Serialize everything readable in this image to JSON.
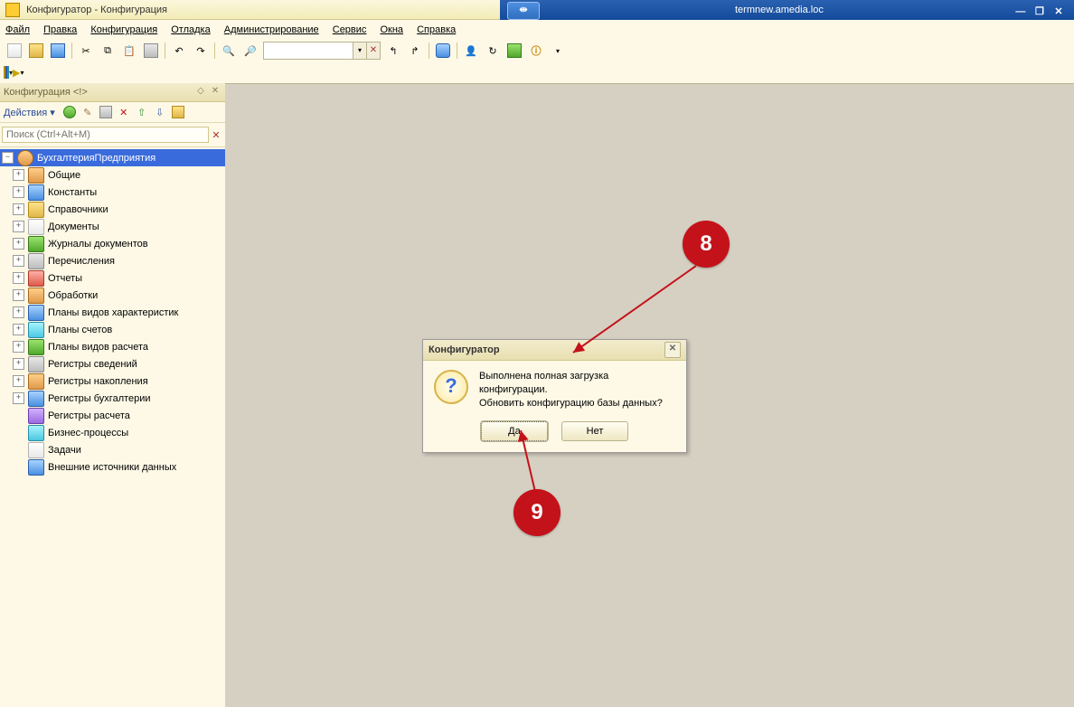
{
  "remote": {
    "host": "termnew.amedia.loc",
    "pin": "⇹"
  },
  "app_title": "Конфигуратор - Конфигурация",
  "menu": [
    "Файл",
    "Правка",
    "Конфигурация",
    "Отладка",
    "Администрирование",
    "Сервис",
    "Окна",
    "Справка"
  ],
  "side": {
    "title": "Конфигурация <!>",
    "actions_label": "Действия ▾",
    "search_placeholder": "Поиск (Ctrl+Alt+M)"
  },
  "tree": {
    "root": "БухгалтерияПредприятия",
    "items": [
      {
        "label": "Общие",
        "ico": "i-orange"
      },
      {
        "label": "Константы",
        "ico": "i-blue"
      },
      {
        "label": "Справочники",
        "ico": "i-fld"
      },
      {
        "label": "Документы",
        "ico": "i-doc"
      },
      {
        "label": "Журналы документов",
        "ico": "i-green"
      },
      {
        "label": "Перечисления",
        "ico": "i-gray"
      },
      {
        "label": "Отчеты",
        "ico": "i-red"
      },
      {
        "label": "Обработки",
        "ico": "i-orange"
      },
      {
        "label": "Планы видов характеристик",
        "ico": "i-blue"
      },
      {
        "label": "Планы счетов",
        "ico": "i-cyan"
      },
      {
        "label": "Планы видов расчета",
        "ico": "i-green"
      },
      {
        "label": "Регистры сведений",
        "ico": "i-gray"
      },
      {
        "label": "Регистры накопления",
        "ico": "i-orange"
      },
      {
        "label": "Регистры бухгалтерии",
        "ico": "i-blue"
      },
      {
        "label": "Регистры расчета",
        "ico": "i-purple",
        "noexp": true
      },
      {
        "label": "Бизнес-процессы",
        "ico": "i-cyan",
        "noexp": true
      },
      {
        "label": "Задачи",
        "ico": "i-doc",
        "noexp": true
      },
      {
        "label": "Внешние источники данных",
        "ico": "i-blue",
        "noexp": true
      }
    ]
  },
  "dialog": {
    "title": "Конфигуратор",
    "line1": "Выполнена полная загрузка конфигурации.",
    "line2": "Обновить конфигурацию базы данных?",
    "yes": "Да",
    "no": "Нет"
  },
  "annotations": {
    "a": "8",
    "b": "9"
  }
}
